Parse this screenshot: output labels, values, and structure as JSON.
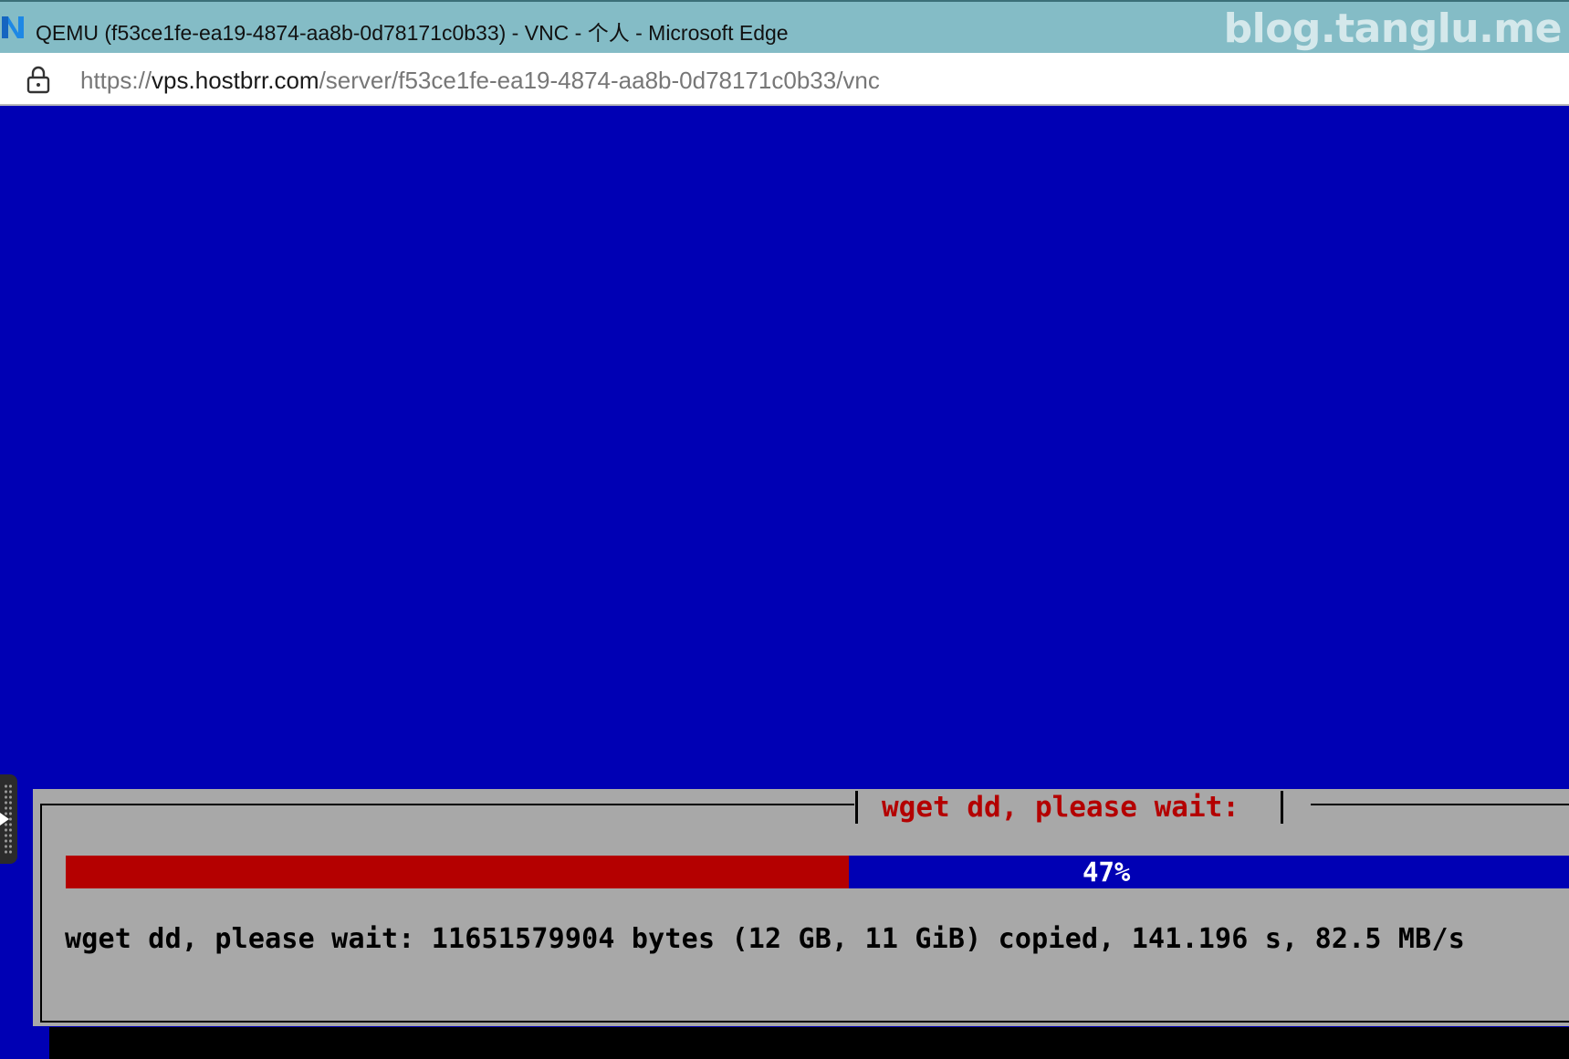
{
  "window": {
    "title": "QEMU (f53ce1fe-ea19-4874-aa8b-0d78171c0b33) - VNC - 个人 - Microsoft Edge",
    "watermark": "blog.tanglu.me",
    "app_icon": "edge-app-icon"
  },
  "address_bar": {
    "lock_icon": "lock-icon",
    "url_scheme": "https://",
    "url_host": "vps.hostbrr.com",
    "url_path": "/server/f53ce1fe-ea19-4874-aa8b-0d78171c0b33/vnc"
  },
  "vnc": {
    "dialog": {
      "title": "wget dd, please wait:",
      "progress_percent": 47,
      "progress_label": "47%",
      "status_text": "wget dd, please wait: 11651579904 bytes (12 GB, 11 GiB) copied, 141.196 s, 82.5 MB/s"
    },
    "colors": {
      "background": "#0000b4",
      "dialog_gray": "#a8a8a8",
      "progress_red": "#b40000",
      "title_red": "#b40000"
    }
  }
}
